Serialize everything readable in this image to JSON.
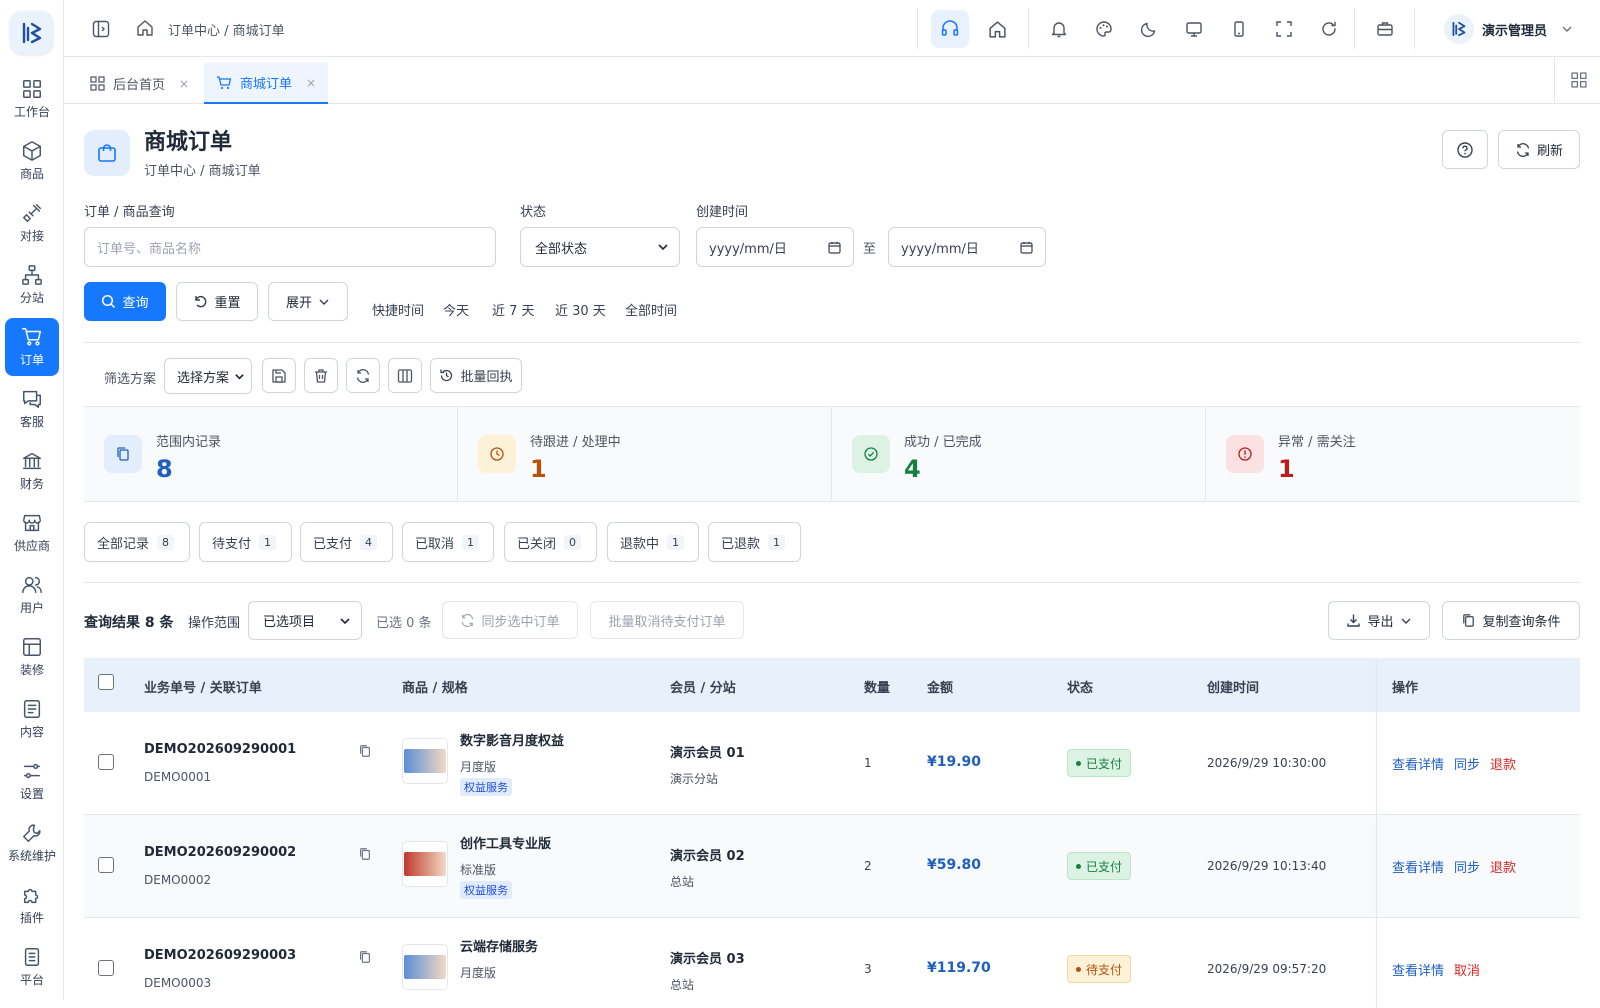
{
  "app": {
    "breadcrumb": "订单中心 / 商城订单",
    "user_name": "演示管理员"
  },
  "sidebar": {
    "items": [
      {
        "label": "工作台",
        "icon": "dashboard-icon"
      },
      {
        "label": "商品",
        "icon": "box-icon"
      },
      {
        "label": "对接",
        "icon": "plug-icon"
      },
      {
        "label": "分站",
        "icon": "sitemap-icon"
      },
      {
        "label": "订单",
        "icon": "cart-icon",
        "active": true
      },
      {
        "label": "客服",
        "icon": "chat-icon"
      },
      {
        "label": "财务",
        "icon": "bank-icon"
      },
      {
        "label": "供应商",
        "icon": "store-icon"
      },
      {
        "label": "用户",
        "icon": "users-icon"
      },
      {
        "label": "装修",
        "icon": "layout-icon"
      },
      {
        "label": "内容",
        "icon": "document-icon"
      },
      {
        "label": "设置",
        "icon": "sliders-icon"
      },
      {
        "label": "系统维护",
        "icon": "wrench-icon"
      },
      {
        "label": "插件",
        "icon": "puzzle-icon"
      },
      {
        "label": "平台",
        "icon": "platform-icon"
      }
    ]
  },
  "tabs": [
    {
      "label": "后台首页",
      "close": "×"
    },
    {
      "label": "商城订单",
      "close": "×",
      "active": true
    }
  ],
  "page": {
    "title": "商城订单",
    "subtitle": "订单中心 / 商城订单",
    "refresh_label": "刷新"
  },
  "filters": {
    "query_label": "订单 / 商品查询",
    "query_placeholder": "订单号、商品名称",
    "status_label": "状态",
    "status_value": "全部状态",
    "created_label": "创建时间",
    "date_from": "yyyy/mm/日",
    "date_to": "yyyy/mm/日",
    "to_label": "至",
    "search_label": "查询",
    "reset_label": "重置",
    "expand_label": "展开",
    "quick_label": "快捷时间",
    "quick_options": [
      "今天",
      "近 7 天",
      "近 30 天",
      "全部时间"
    ]
  },
  "scheme": {
    "label": "筛选方案",
    "select_value": "选择方案",
    "batch_label": "批量回执"
  },
  "stats": [
    {
      "label": "范围内记录",
      "value": "8",
      "color": "#1e5fbf"
    },
    {
      "label": "待跟进 / 处理中",
      "value": "1",
      "color": "#b45309"
    },
    {
      "label": "成功 / 已完成",
      "value": "4",
      "color": "#15803d"
    },
    {
      "label": "异常 / 需关注",
      "value": "1",
      "color": "#b91c1c"
    }
  ],
  "status_chips": [
    {
      "label": "全部记录",
      "count": "8"
    },
    {
      "label": "待支付",
      "count": "1"
    },
    {
      "label": "已支付",
      "count": "4"
    },
    {
      "label": "已取消",
      "count": "1"
    },
    {
      "label": "已关闭",
      "count": "0"
    },
    {
      "label": "退款中",
      "count": "1"
    },
    {
      "label": "已退款",
      "count": "1"
    }
  ],
  "results": {
    "count_label": "查询结果 8 条",
    "scope_label": "操作范围",
    "scope_value": "已选项目",
    "selected_label": "已选 0 条",
    "sync_label": "同步选中订单",
    "batch_cancel_label": "批量取消待支付订单",
    "export_label": "导出",
    "copy_label": "复制查询条件"
  },
  "table": {
    "headers": [
      "业务单号 / 关联订单",
      "商品 / 规格",
      "会员 / 分站",
      "数量",
      "金额",
      "状态",
      "创建时间",
      "操作"
    ],
    "rows": [
      {
        "order_no": "DEMO202609290001",
        "ref": "DEMO0001",
        "product": "数字影音月度权益",
        "spec": "月度版",
        "tag": "权益服务",
        "member": "演示会员 01",
        "site": "演示分站",
        "qty": "1",
        "amount": "¥19.90",
        "status": "已支付",
        "status_type": "paid",
        "created": "2026/9/29 10:30:00",
        "ops": [
          "查看详情",
          "同步",
          "退款"
        ]
      },
      {
        "order_no": "DEMO202609290002",
        "ref": "DEMO0002",
        "product": "创作工具专业版",
        "spec": "标准版",
        "tag": "权益服务",
        "member": "演示会员 02",
        "site": "总站",
        "qty": "2",
        "amount": "¥59.80",
        "status": "已支付",
        "status_type": "paid",
        "created": "2026/9/29 10:13:40",
        "ops": [
          "查看详情",
          "同步",
          "退款"
        ]
      },
      {
        "order_no": "DEMO202609290003",
        "ref": "DEMO0003",
        "product": "云端存储服务",
        "spec": "月度版",
        "tag": "",
        "member": "演示会员 03",
        "site": "总站",
        "qty": "3",
        "amount": "¥119.70",
        "status": "待支付",
        "status_type": "pending",
        "created": "2026/9/29 09:57:20",
        "ops": [
          "查看详情",
          "取消"
        ]
      }
    ]
  }
}
